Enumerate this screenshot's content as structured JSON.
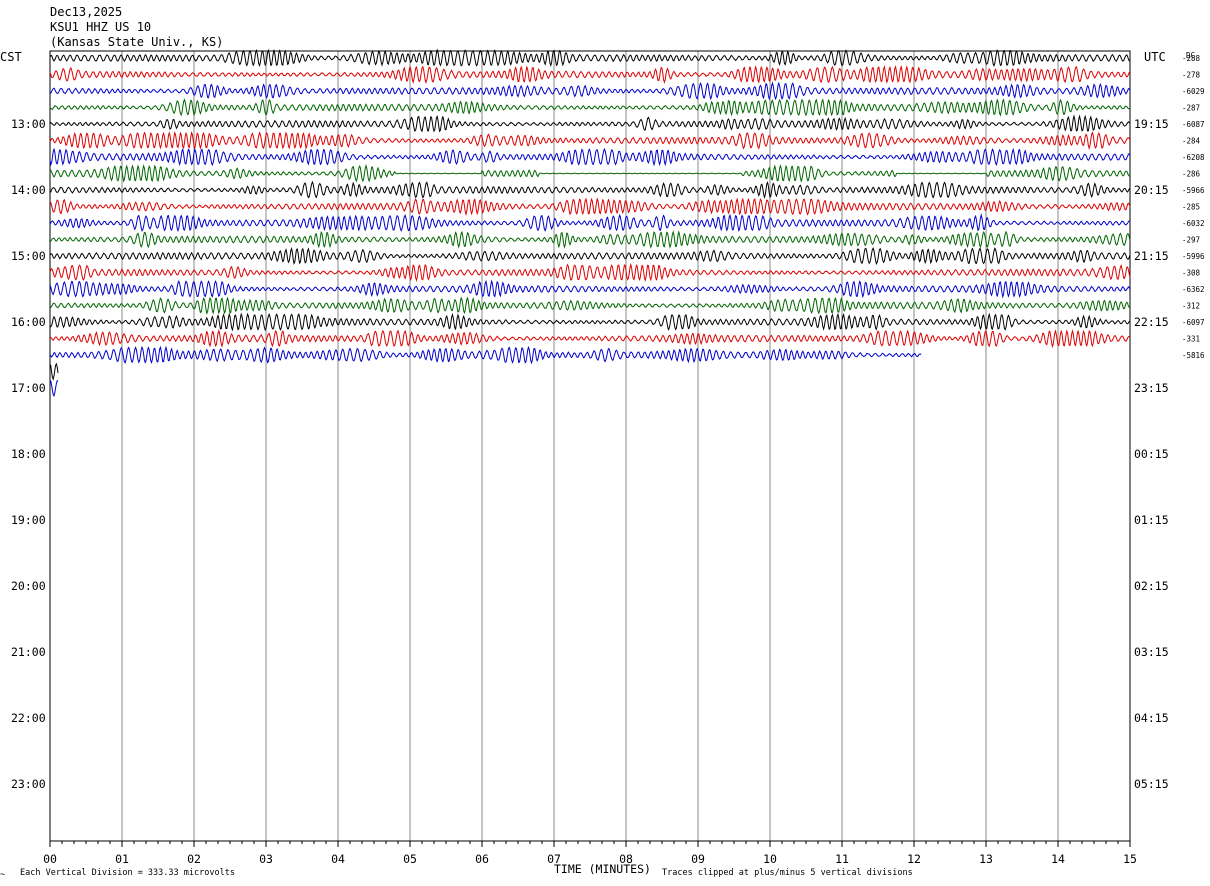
{
  "header": {
    "date": "Dec13,2025",
    "station": "KSU1 HHZ US 10",
    "location": "(Kansas State Univ., KS)"
  },
  "left_axis_label": "CST",
  "right_axis_label": "UTC",
  "dc_label": "DC",
  "footer": {
    "division_note": "Each Vertical Division =  333.33 microvolts",
    "xlabel": "TIME (MINUTES)",
    "clip_note": "Traces clipped at plus/minus 5 vertical divisions"
  },
  "chart_data": {
    "type": "line",
    "title": "KSU1 HHZ US 10",
    "xlabel": "TIME (MINUTES)",
    "xlim": [
      0,
      15
    ],
    "x_ticks": [
      "00",
      "01",
      "02",
      "03",
      "04",
      "05",
      "06",
      "07",
      "08",
      "09",
      "10",
      "11",
      "12",
      "13",
      "14",
      "15"
    ],
    "grid": "vertical lines each minute",
    "left_hour_labels": [
      "13:00",
      "14:00",
      "15:00",
      "16:00",
      "17:00",
      "18:00",
      "19:00",
      "20:00",
      "21:00",
      "22:00",
      "23:00"
    ],
    "right_hour_labels": [
      "19:15",
      "20:15",
      "21:15",
      "22:15",
      "23:15",
      "00:15",
      "01:15",
      "02:15",
      "03:15",
      "04:15",
      "05:15"
    ],
    "trace_colors": [
      "#000000",
      "#dd0000",
      "#0000cc",
      "#006600"
    ],
    "traces": [
      {
        "color": "#000000",
        "dc": "-288",
        "start_min": 0,
        "end_min": 15
      },
      {
        "color": "#dd0000",
        "dc": "-278",
        "start_min": 0,
        "end_min": 15
      },
      {
        "color": "#0000cc",
        "dc": "-6029",
        "start_min": 0,
        "end_min": 15
      },
      {
        "color": "#006600",
        "dc": "-287",
        "start_min": 0,
        "end_min": 15
      },
      {
        "color": "#000000",
        "dc": "-6087",
        "start_min": 0,
        "end_min": 15
      },
      {
        "color": "#dd0000",
        "dc": "-284",
        "start_min": 0,
        "end_min": 15
      },
      {
        "color": "#0000cc",
        "dc": "-6208",
        "start_min": 0,
        "end_min": 15
      },
      {
        "color": "#006600",
        "dc": "-286",
        "start_min": 0,
        "end_min": 15,
        "quiet_gaps": [
          [
            4.8,
            6.0
          ],
          [
            6.8,
            9.6
          ],
          [
            11.75,
            13.0
          ]
        ]
      },
      {
        "color": "#000000",
        "dc": "-5966",
        "start_min": 0,
        "end_min": 15
      },
      {
        "color": "#dd0000",
        "dc": "-285",
        "start_min": 0,
        "end_min": 15
      },
      {
        "color": "#0000cc",
        "dc": "-6032",
        "start_min": 0,
        "end_min": 15
      },
      {
        "color": "#006600",
        "dc": "-297",
        "start_min": 0,
        "end_min": 15
      },
      {
        "color": "#000000",
        "dc": "-5996",
        "start_min": 0,
        "end_min": 15
      },
      {
        "color": "#dd0000",
        "dc": "-308",
        "start_min": 0,
        "end_min": 15
      },
      {
        "color": "#0000cc",
        "dc": "-6362",
        "start_min": 0,
        "end_min": 15
      },
      {
        "color": "#006600",
        "dc": "-312",
        "start_min": 0,
        "end_min": 15
      },
      {
        "color": "#000000",
        "dc": "-6097",
        "start_min": 0,
        "end_min": 15
      },
      {
        "color": "#dd0000",
        "dc": "-331",
        "start_min": 0,
        "end_min": 15
      },
      {
        "color": "#0000cc",
        "dc": "-5816",
        "start_min": 0,
        "end_min": 12.1
      },
      {
        "color": "#000000",
        "dc": "",
        "start_min": 0,
        "end_min": 0.12
      },
      {
        "color": "#0000cc",
        "dc": "",
        "start_min": 0,
        "end_min": 0.12
      }
    ]
  }
}
